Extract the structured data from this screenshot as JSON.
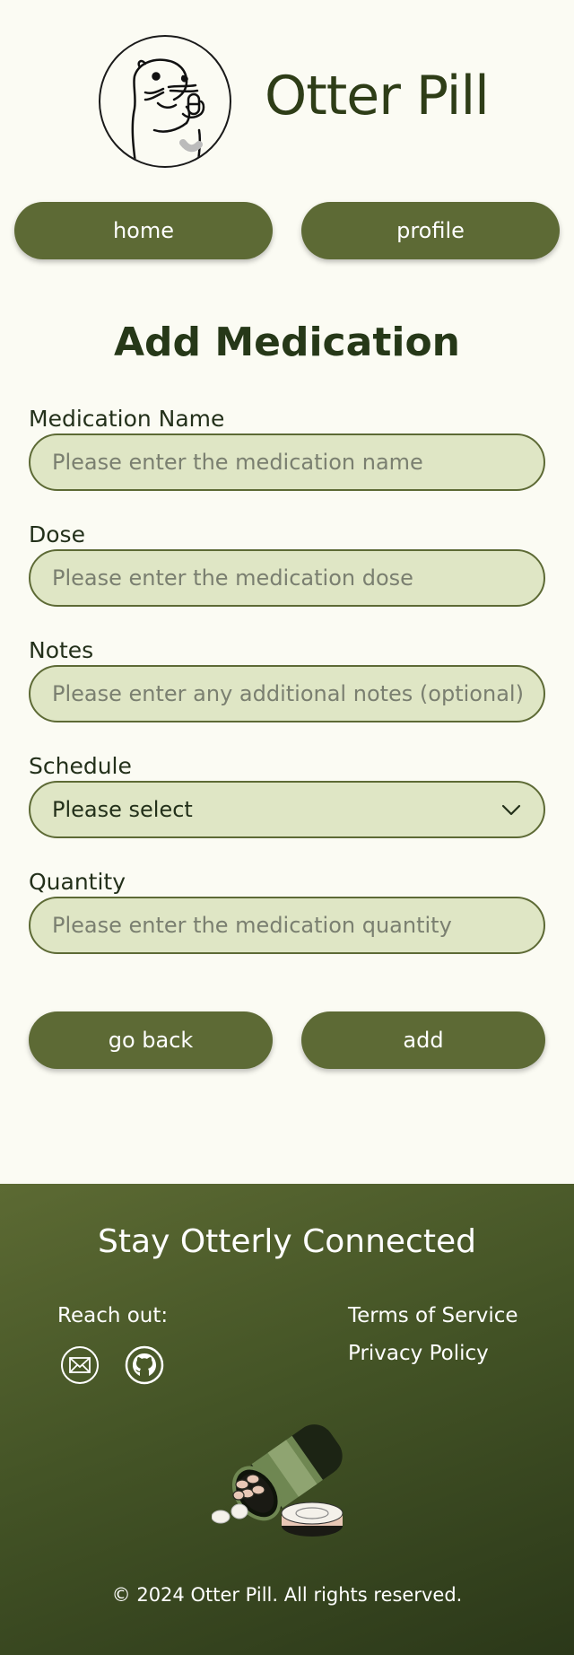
{
  "header": {
    "app_title": "Otter Pill"
  },
  "nav": {
    "home_label": "home",
    "profile_label": "profile"
  },
  "form": {
    "title": "Add Medication",
    "fields": [
      {
        "label": "Medication Name",
        "placeholder": "Please enter the medication name",
        "value": ""
      },
      {
        "label": "Dose",
        "placeholder": "Please enter the medication dose",
        "value": ""
      },
      {
        "label": "Notes",
        "placeholder": "Please enter any additional notes (optional)",
        "value": ""
      },
      {
        "label": "Schedule",
        "selected": "Please select",
        "icon": "chevron-down-icon"
      },
      {
        "label": "Quantity",
        "placeholder": "Please enter the medication quantity",
        "value": ""
      }
    ],
    "back_label": "go back",
    "add_label": "add"
  },
  "footer": {
    "title": "Stay Otterly Connected",
    "reach_out": "Reach out:",
    "social_icons": [
      "mail-icon",
      "github-icon"
    ],
    "links": [
      "Terms of Service",
      "Privacy Policy"
    ],
    "copyright": "© 2024 Otter Pill. All rights reserved."
  },
  "colors": {
    "background": "#fbfbf3",
    "button": "#5d6a35",
    "input_fill": "#dfe6c5",
    "footer_start": "#5c6a33",
    "footer_end": "#2b3819"
  }
}
